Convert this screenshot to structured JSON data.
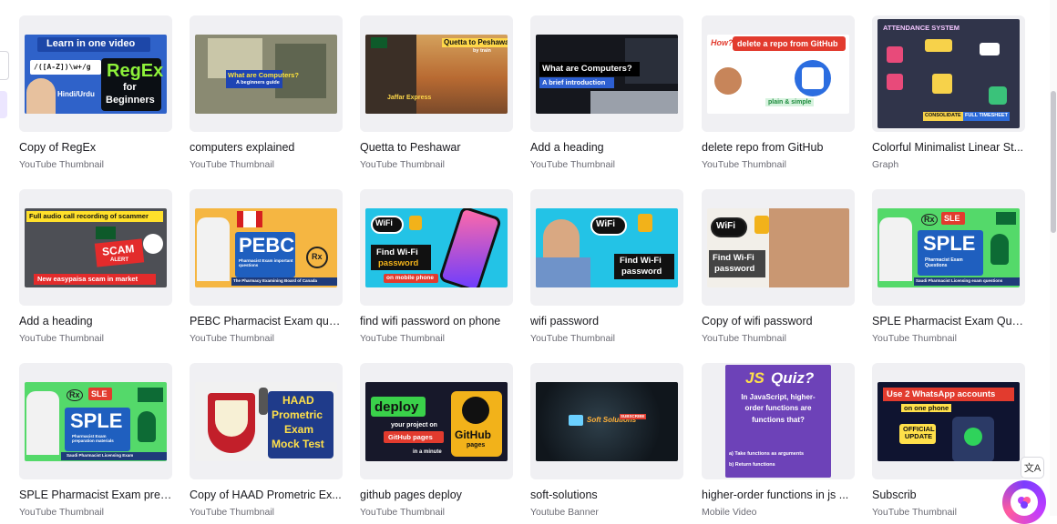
{
  "designs": [
    {
      "title": "Copy of RegEx",
      "type": "YouTube Thumbnail",
      "thumb": {
        "learn": "Learn in one video",
        "regex": "RegEx",
        "for": "for",
        "beginners": "Beginners",
        "pattern": "/([A-Z])\\w+/g",
        "lang": "Hindi/Urdu"
      }
    },
    {
      "title": "computers explained",
      "type": "YouTube Thumbnail",
      "thumb": {
        "question": "What are Computers?",
        "guide": "A beginners guide"
      }
    },
    {
      "title": "Quetta to Peshawar",
      "type": "YouTube Thumbnail",
      "thumb": {
        "route": "Quetta to Peshawar",
        "by": "by train",
        "train": "Jaffar Express"
      }
    },
    {
      "title": "Add a heading",
      "type": "YouTube Thumbnail",
      "thumb": {
        "question": "What are Computers?",
        "intro": "A brief introduction"
      }
    },
    {
      "title": "delete repo from GitHub",
      "type": "YouTube Thumbnail",
      "thumb": {
        "how": "How?",
        "banner": "delete a repo from GitHub",
        "tag": "plain & simple"
      }
    },
    {
      "title": "Colorful Minimalist Linear St...",
      "type": "Graph",
      "thumb": {
        "heading": "ATTENDANCE SYSTEM",
        "consolidate": "CONSOLIDATE",
        "timesheet": "FULL TIMESHEET"
      }
    },
    {
      "title": "Add a heading",
      "type": "YouTube Thumbnail",
      "thumb": {
        "top": "Full audio call recording of scammer",
        "scam": "SCAM",
        "alert": "ALERT",
        "bottom": "New easypaisa scam in market"
      }
    },
    {
      "title": "PEBC Pharmacist Exam ques...",
      "type": "YouTube Thumbnail",
      "thumb": {
        "big": "PEBC",
        "sub": "Pharmacist Exam important questions",
        "footer": "The Pharmacy Examining Board of Canada",
        "rx": "Rx"
      }
    },
    {
      "title": "find wifi password on phone",
      "type": "YouTube Thumbnail",
      "thumb": {
        "wifi": "WiFi",
        "find": "Find Wi-Fi",
        "password": "password",
        "footer": "on mobile phone"
      }
    },
    {
      "title": "wifi password",
      "type": "YouTube Thumbnail",
      "thumb": {
        "wifi": "WiFi",
        "find": "Find Wi-Fi",
        "password": "password"
      }
    },
    {
      "title": "Copy of wifi password",
      "type": "YouTube Thumbnail",
      "thumb": {
        "wifi": "WiFi",
        "find": "Find Wi-Fi",
        "password": "password"
      }
    },
    {
      "title": "SPLE Pharmacist Exam Ques...",
      "type": "YouTube Thumbnail",
      "thumb": {
        "sle": "SLE",
        "big": "SPLE",
        "sub": "Pharmacist Exam Questions",
        "footer": "Saudi Pharmacist Licensing exam questions",
        "rx": "Rx"
      }
    },
    {
      "title": "SPLE Pharmacist Exam prep ...",
      "type": "YouTube Thumbnail",
      "thumb": {
        "sle": "SLE",
        "big": "SPLE",
        "sub": "Pharmacist Exam preparation materials",
        "footer": "Saudi Pharmacist Licensing Exam",
        "rx": "Rx"
      }
    },
    {
      "title": "Copy of HAAD Prometric Ex...",
      "type": "YouTube Thumbnail",
      "thumb": {
        "line1": "HAAD",
        "line2": "Prometric",
        "line3": "Exam",
        "line4": "Mock Test"
      }
    },
    {
      "title": "github pages deploy",
      "type": "YouTube Thumbnail",
      "thumb": {
        "deploy": "deploy",
        "your": "your project on",
        "pages": "GitHub pages",
        "minute": "in a minute",
        "github": "GitHub",
        "gp": "pages"
      }
    },
    {
      "title": "soft-solutions",
      "type": "Youtube Banner",
      "thumb": {
        "brand": "Soft Solutions",
        "sub": "SUBSCRIBE"
      }
    },
    {
      "title": "higher-order functions in js ...",
      "type": "Mobile Video",
      "thumb": {
        "js": "JS",
        "quiz": "Quiz?",
        "q": "In JavaScript, higher-order functions are functions that?",
        "a": "a) Take functions as arguments",
        "b": "b) Return functions"
      }
    },
    {
      "title": "Subscrib",
      "type": "YouTube Thumbnail",
      "thumb": {
        "banner": "Use 2 WhatsApp accounts",
        "sub": "on one phone",
        "official": "OFFICIAL UPDATE"
      }
    }
  ],
  "ui": {
    "translate": "文A"
  }
}
